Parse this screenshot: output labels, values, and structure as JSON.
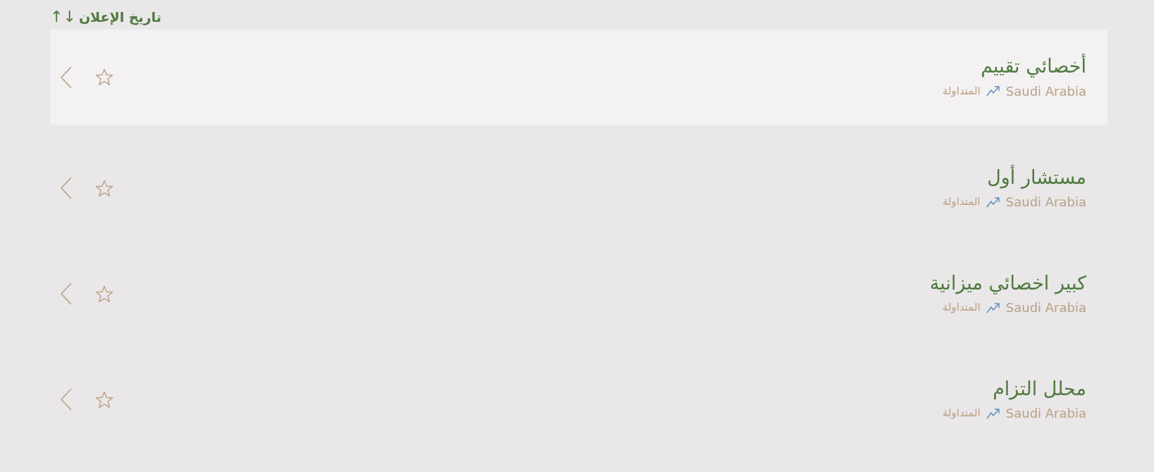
{
  "sort_header": {
    "label": "تاريخ الإعلان",
    "arrows": "↑↓"
  },
  "jobs": [
    {
      "title": "أخصائي تقييم",
      "location": "Saudi Arabia",
      "company": "المتداولة",
      "selected": true,
      "starred": false
    },
    {
      "title": "مستشار أول",
      "location": "Saudi Arabia",
      "company": "المتداولة",
      "selected": false,
      "starred": false
    },
    {
      "title": "كبير اخصائي ميزانية",
      "location": "Saudi Arabia",
      "company": "المتداولة",
      "selected": false,
      "starred": false
    },
    {
      "title": "محلل التزام",
      "location": "Saudi Arabia",
      "company": "المتداولة",
      "selected": false,
      "starred": false
    }
  ]
}
